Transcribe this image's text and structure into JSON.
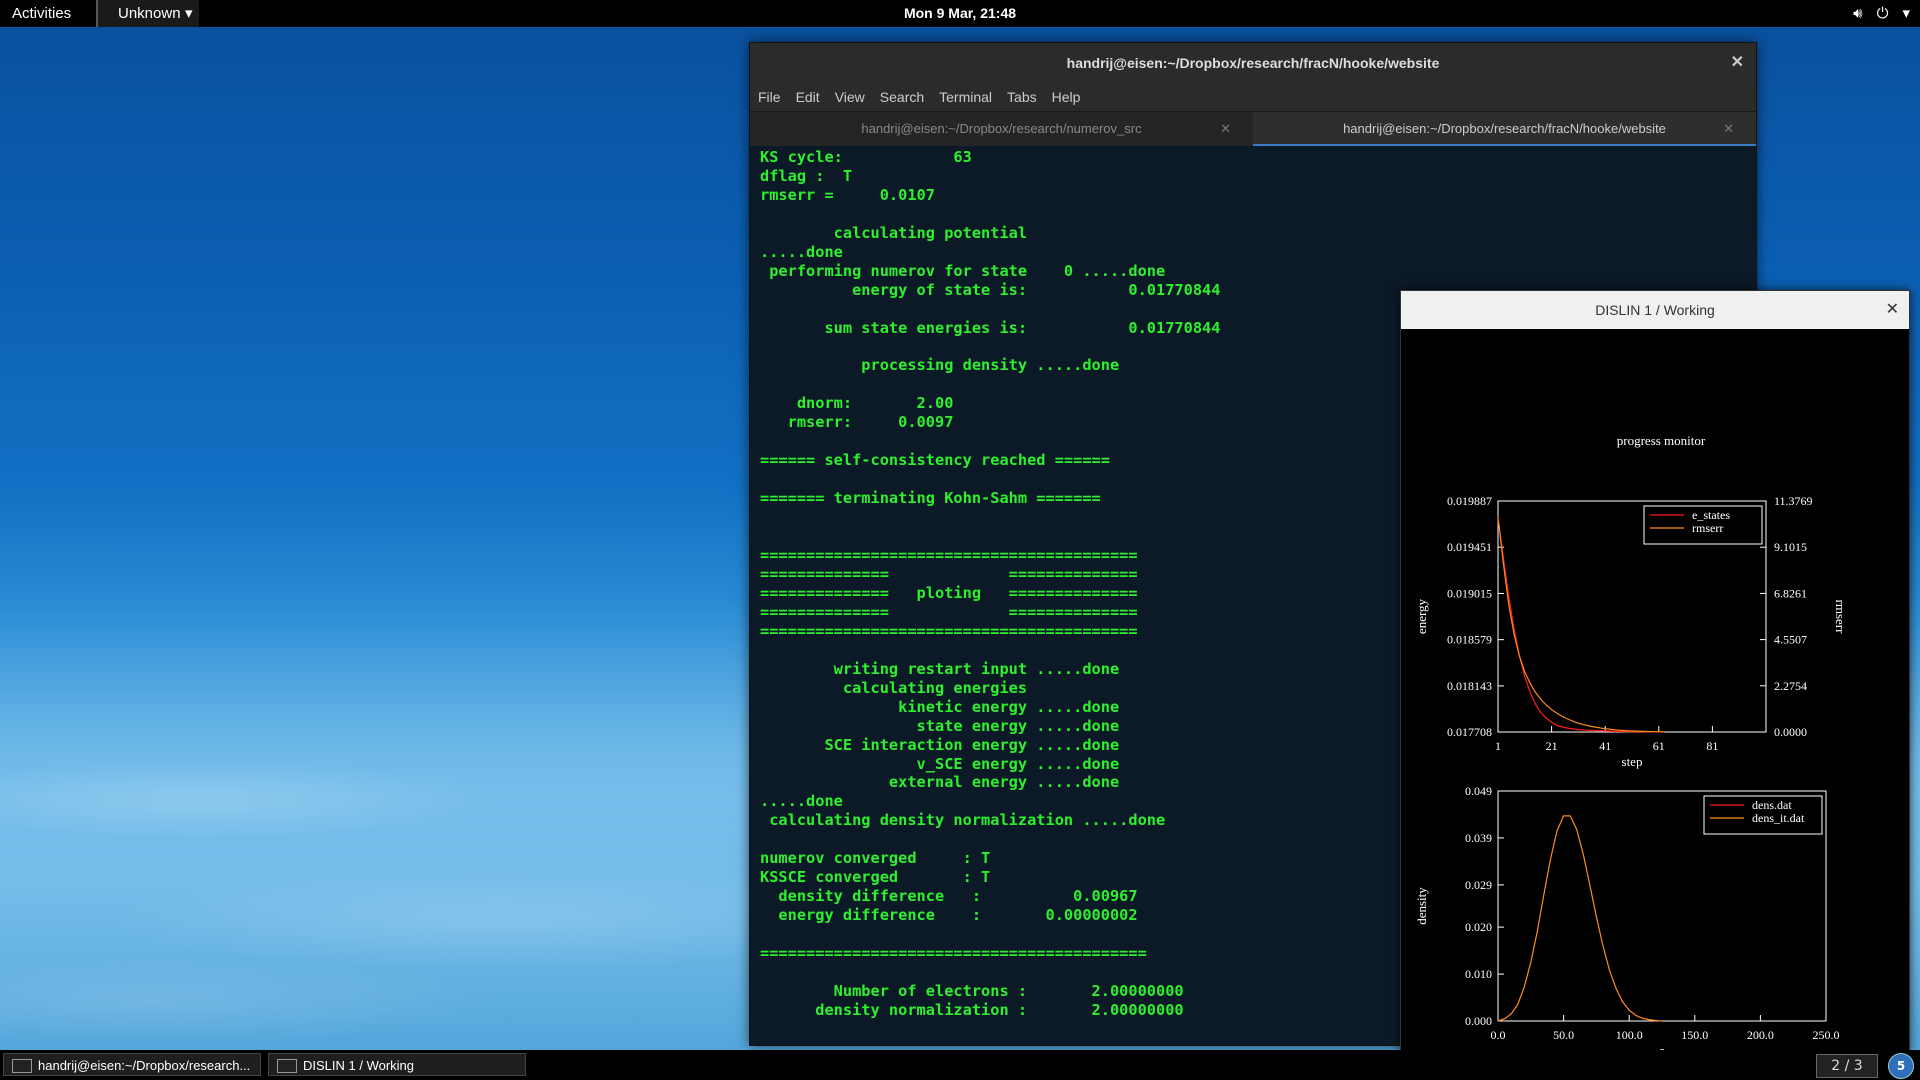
{
  "topbar": {
    "activities": "Activities",
    "app_menu": "Unknown",
    "clock": "Mon  9 Mar, 21:48"
  },
  "terminal": {
    "title": "handrij@eisen:~/Dropbox/research/fracN/hooke/website",
    "menu": [
      "File",
      "Edit",
      "View",
      "Search",
      "Terminal",
      "Tabs",
      "Help"
    ],
    "tabs": [
      {
        "label": "handrij@eisen:~/Dropbox/research/numerov_src"
      },
      {
        "label": "handrij@eisen:~/Dropbox/research/fracN/hooke/website"
      }
    ],
    "output": "KS cycle:            63\ndflag :  T\nrmserr =     0.0107\n\n        calculating potential\n.....done\n performing numerov for state    0 .....done\n          energy of state is:           0.01770844\n\n       sum state energies is:           0.01770844\n\n           processing density .....done\n\n    dnorm:       2.00\n   rmserr:     0.0097\n\n====== self-consistency reached ======\n\n======= terminating Kohn-Sahm =======\n\n\n=========================================\n==============             ==============\n==============   ploting   ==============\n==============             ==============\n=========================================\n\n        writing restart input .....done\n         calculating energies\n               kinetic energy .....done\n                 state energy .....done\n       SCE interaction energy .....done\n                 v_SCE energy .....done\n              external energy .....done\n.....done\n calculating density normalization .....done\n\nnumerov converged     : T\nKSSCE converged       : T\n  density difference   :          0.00967\n  energy difference    :       0.00000002\n\n==========================================\n\n        Number of electrons :       2.00000000\n      density normalization :       2.00000000"
  },
  "dislin": {
    "title": "DISLIN 1 / Working",
    "heading": "progress monitor",
    "chart_data": [
      {
        "type": "line",
        "xlabel": "step",
        "ylabel": "energy",
        "y2label": "rmserr",
        "xlim": [
          1,
          101
        ],
        "ylim": [
          0.017708,
          0.019887
        ],
        "y2lim": [
          0.0,
          11.3769
        ],
        "xticks": [
          "1",
          "21",
          "41",
          "61",
          "81"
        ],
        "yticks": [
          "0.017708",
          "0.018143",
          "0.018579",
          "0.019015",
          "0.019451",
          "0.019887"
        ],
        "y2ticks": [
          "0.0000",
          "2.2754",
          "4.5507",
          "6.8261",
          "9.1015",
          "11.3769"
        ],
        "legend_position": "top-right",
        "series": [
          {
            "name": "e_states",
            "color": "#ff1a1a",
            "axis": "left",
            "x": [
              1,
              3,
              5,
              7,
              9,
              11,
              13,
              15,
              17,
              19,
              21,
              23,
              25,
              27,
              29,
              31,
              35,
              40,
              45,
              50,
              55,
              60,
              63
            ],
            "y": [
              0.01972,
              0.01935,
              0.01899,
              0.01868,
              0.01843,
              0.01823,
              0.01808,
              0.01797,
              0.01789,
              0.01784,
              0.0178,
              0.01777,
              0.017755,
              0.017745,
              0.017737,
              0.017731,
              0.017724,
              0.017718,
              0.017714,
              0.017711,
              0.01771,
              0.017709,
              0.017709
            ]
          },
          {
            "name": "rmserr",
            "color": "#ff8c1a",
            "axis": "right",
            "x": [
              1,
              3,
              5,
              7,
              9,
              11,
              13,
              15,
              17,
              19,
              21,
              23,
              25,
              27,
              30,
              33,
              36,
              40,
              45,
              50,
              55,
              60,
              63
            ],
            "y": [
              10.6,
              8.3,
              6.3,
              4.8,
              3.75,
              2.95,
              2.4,
              1.95,
              1.6,
              1.33,
              1.1,
              0.92,
              0.77,
              0.64,
              0.48,
              0.36,
              0.27,
              0.18,
              0.1,
              0.055,
              0.03,
              0.015,
              0.01
            ]
          }
        ]
      },
      {
        "type": "line",
        "xlabel": "r",
        "ylabel": "density",
        "xlim": [
          0.0,
          250.0
        ],
        "ylim": [
          0.0,
          0.049
        ],
        "xticks": [
          "0.0",
          "50.0",
          "100.0",
          "150.0",
          "200.0",
          "250.0"
        ],
        "yticks": [
          "0.000",
          "0.010",
          "0.020",
          "0.029",
          "0.039",
          "0.049"
        ],
        "legend_position": "top-right",
        "series": [
          {
            "name": "dens.dat",
            "color": "#ff1a1a"
          },
          {
            "name": "dens_it.dat",
            "color": "#ff8c1a",
            "x": [
              0,
              5,
              10,
              15,
              20,
              25,
              30,
              35,
              40,
              45,
              50,
              55,
              60,
              65,
              70,
              75,
              80,
              85,
              90,
              95,
              100,
              105,
              110,
              115,
              120,
              125
            ],
            "y": [
              0.0,
              0.0005,
              0.0015,
              0.0035,
              0.0072,
              0.0125,
              0.0192,
              0.027,
              0.0345,
              0.0405,
              0.0437,
              0.0437,
              0.0408,
              0.0355,
              0.029,
              0.0222,
              0.016,
              0.0108,
              0.0069,
              0.0041,
              0.0023,
              0.0012,
              0.0006,
              0.0003,
              0.0001,
              0.0
            ]
          }
        ]
      }
    ]
  },
  "taskbar": {
    "items": [
      {
        "label": "handrij@eisen:~/Dropbox/research..."
      },
      {
        "label": "DISLIN 1 / Working"
      }
    ],
    "workspace": "2 / 3",
    "notifications": "5"
  }
}
